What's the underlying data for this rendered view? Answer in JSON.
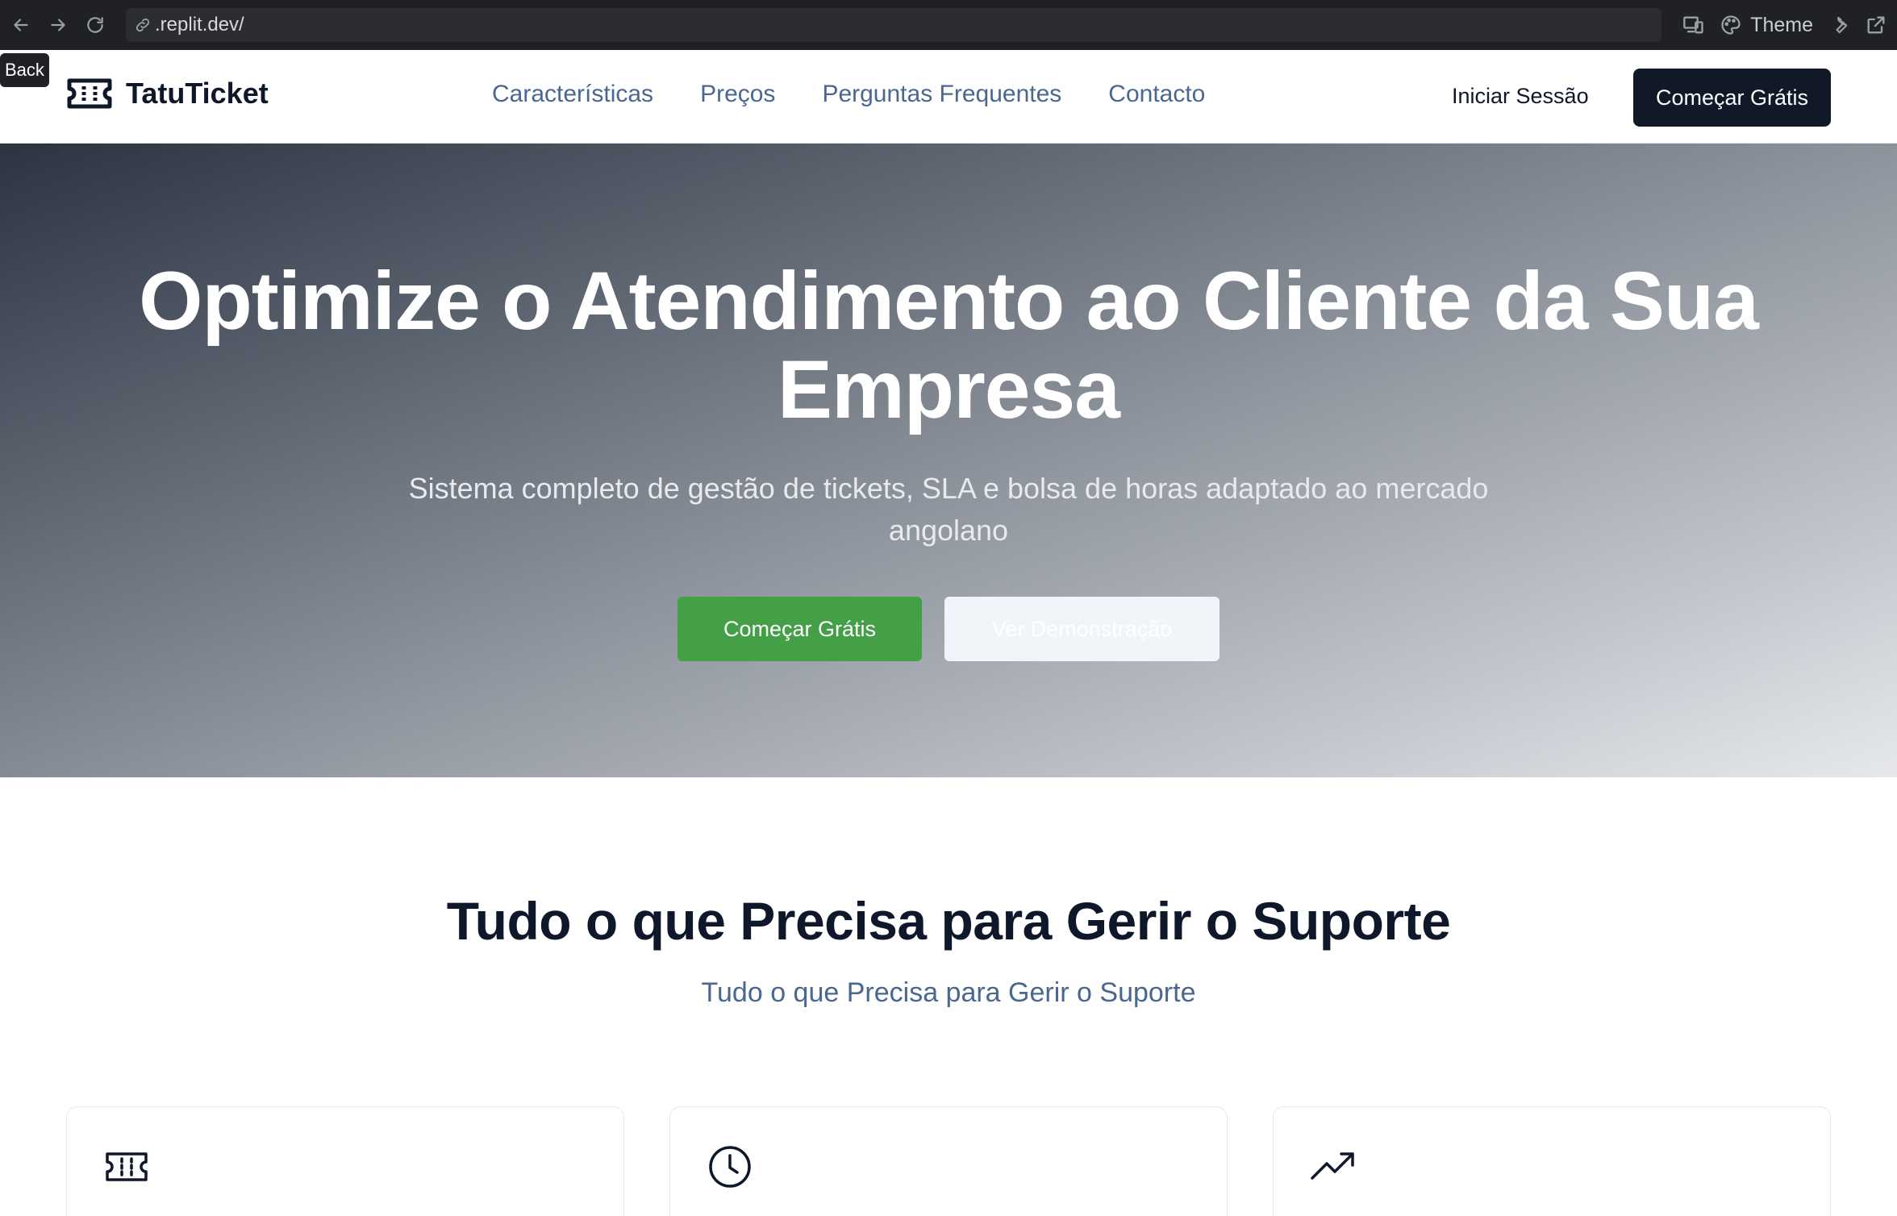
{
  "browser": {
    "url": ".replit.dev/",
    "theme_label": "Theme",
    "back_tooltip": "Back",
    "icons": [
      "arrow-left-icon",
      "arrow-right-icon",
      "reload-icon",
      "link-icon",
      "devices-icon",
      "palette-icon",
      "wrench-icon",
      "external-link-icon"
    ]
  },
  "header": {
    "brand": "TatuTicket",
    "nav": [
      "Características",
      "Preços",
      "Perguntas Frequentes",
      "Contacto"
    ],
    "login": "Iniciar Sessão",
    "cta": "Começar Grátis"
  },
  "hero": {
    "title": "Optimize o Atendimento ao Cliente da Sua Empresa",
    "subtitle": "Sistema completo de gestão de tickets, SLA e bolsa de horas adaptado ao mercado angolano",
    "primary_cta": "Começar Grátis",
    "secondary_cta": "Ver Demonstração"
  },
  "features": {
    "title": "Tudo o que Precisa para Gerir o Suporte",
    "subtitle": "Tudo o que Precisa para Gerir o Suporte",
    "cards": [
      {
        "icon": "ticket-icon"
      },
      {
        "icon": "clock-icon"
      },
      {
        "icon": "trending-up-icon"
      }
    ]
  },
  "colors": {
    "primary_dark": "#111827",
    "accent_green": "#43a047",
    "nav_link": "#4a6790"
  }
}
